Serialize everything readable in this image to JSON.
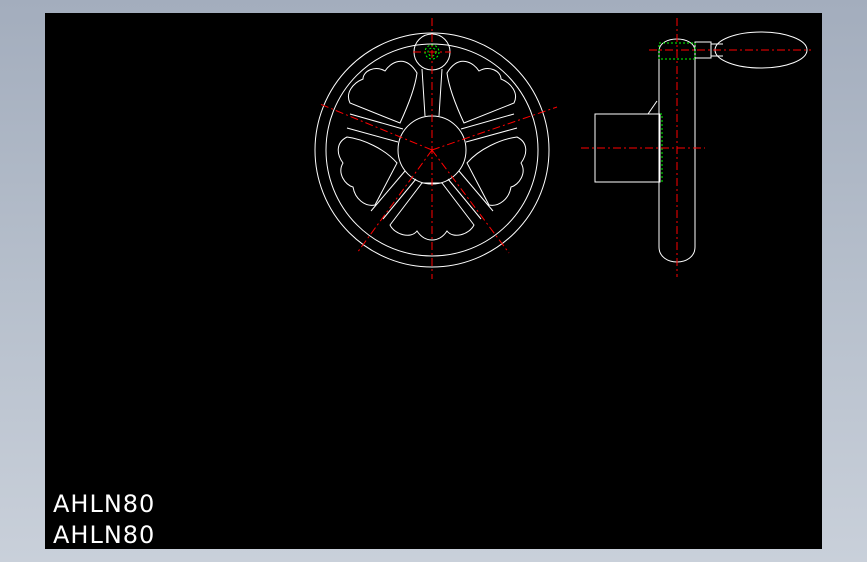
{
  "viewer": {
    "background_color": "#000000",
    "frame_color": "#b4bdca"
  },
  "drawing": {
    "part_labels": [
      "AHLN80",
      "AHLN80"
    ],
    "colors": {
      "outline": "#ffffff",
      "centerline": "#ff0000",
      "hidden": "#00ff00"
    }
  }
}
